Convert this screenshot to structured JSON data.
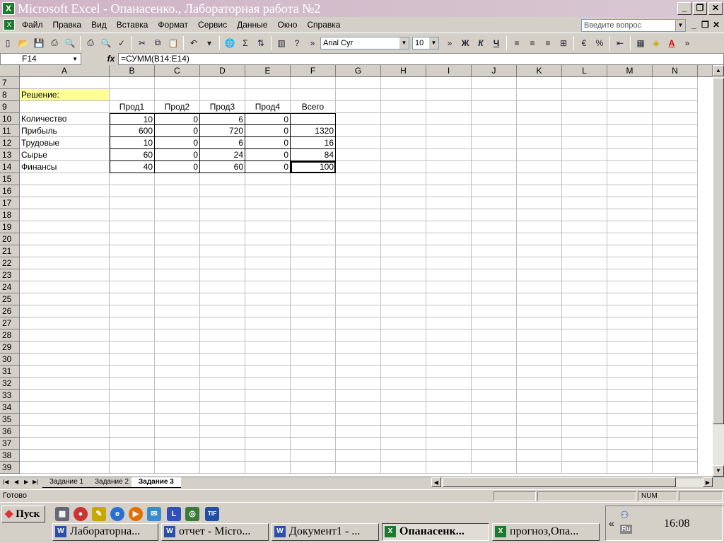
{
  "window": {
    "title": "Microsoft Excel - Опанасенко., Лабораторная работа №2",
    "app_icon": "excel-icon",
    "min": "_",
    "restore": "❐",
    "close": "✕"
  },
  "menu": {
    "items": [
      "Файл",
      "Правка",
      "Вид",
      "Вставка",
      "Формат",
      "Сервис",
      "Данные",
      "Окно",
      "Справка"
    ],
    "help_placeholder": "Введите вопрос"
  },
  "toolbar": {
    "font": "Arial Cyr",
    "size": "10",
    "bold": "Ж",
    "italic": "К",
    "underline": "Ч",
    "percent": "%",
    "sum": "Σ"
  },
  "formula_bar": {
    "name_box": "F14",
    "fx": "fx",
    "formula": "=СУММ(B14:E14)"
  },
  "columns": [
    "A",
    "B",
    "C",
    "D",
    "E",
    "F",
    "G",
    "H",
    "I",
    "J",
    "K",
    "L",
    "M",
    "N"
  ],
  "rows": [
    "7",
    "8",
    "9",
    "10",
    "11",
    "12",
    "13",
    "14",
    "15",
    "16",
    "17",
    "18",
    "19",
    "20",
    "21",
    "22",
    "23",
    "24",
    "25",
    "26",
    "27",
    "28",
    "29",
    "30",
    "31",
    "32",
    "33",
    "34",
    "35",
    "36",
    "37",
    "38",
    "39"
  ],
  "sheet": {
    "r8": {
      "a": "Решение:"
    },
    "r9": {
      "b": "Прод1",
      "c": "Прод2",
      "d": "Прод3",
      "e": "Прод4",
      "f": "Всего"
    },
    "r10": {
      "a": "Количество",
      "b": "10",
      "c": "0",
      "d": "6",
      "e": "0",
      "f": ""
    },
    "r11": {
      "a": "Прибыль",
      "b": "600",
      "c": "0",
      "d": "720",
      "e": "0",
      "f": "1320"
    },
    "r12": {
      "a": "Трудовые",
      "b": "10",
      "c": "0",
      "d": "6",
      "e": "0",
      "f": "16"
    },
    "r13": {
      "a": "Сырье",
      "b": "60",
      "c": "0",
      "d": "24",
      "e": "0",
      "f": "84"
    },
    "r14": {
      "a": "Финансы",
      "b": "40",
      "c": "0",
      "d": "60",
      "e": "0",
      "f": "100"
    }
  },
  "tabs": [
    "Задание 1",
    "Задание 2",
    "Задание 3"
  ],
  "status": {
    "text": "Готово",
    "num": "NUM"
  },
  "taskbar": {
    "start": "Пуск",
    "tasks": [
      "Лабораторна...",
      "отчет - Micro...",
      "Документ1 - ...",
      "Опанасенк...",
      "прогноз,Опа..."
    ],
    "clock": "16:08",
    "lang": "Ru"
  },
  "colors": {
    "title_bg": "#cfb3c5",
    "highlight": "#ffff99",
    "excel_green": "#1b7a2e"
  }
}
